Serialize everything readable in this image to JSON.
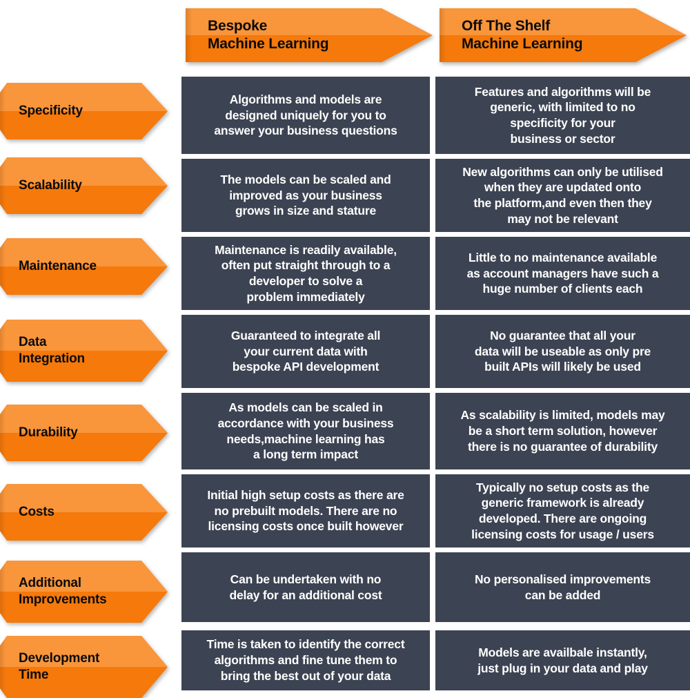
{
  "title": "Bespoke Machine Learning vs Off The Shelf Machine Learning",
  "colors": {
    "orange_light": "#F9953A",
    "orange_dark": "#F5790B",
    "cell_background": "#3C4352",
    "cell_text": "#FFFFFF",
    "label_text": "#0B0B0B",
    "page_background": "#FFFFFF"
  },
  "headers": [
    {
      "id": "bespoke",
      "label": "Bespoke\nMachine Learning"
    },
    {
      "id": "off-the-shelf",
      "label": "Off The Shelf\nMachine Learning"
    }
  ],
  "rows": [
    {
      "id": "specificity",
      "label": "Specificity",
      "bespoke": "Algorithms and models are\ndesigned uniquely for you to\nanswer your business questions",
      "off_the_shelf": "Features and algorithms will be\ngeneric, with limited to no\nspecificity for your\nbusiness or sector"
    },
    {
      "id": "scalability",
      "label": "Scalability",
      "bespoke": "The models can be scaled and\nimproved as your business\ngrows in size and stature",
      "off_the_shelf": "New algorithms can only be utilised\nwhen they are updated onto\nthe platform,and even then they\nmay not be relevant"
    },
    {
      "id": "maintenance",
      "label": "Maintenance",
      "bespoke": "Maintenance is readily available,\noften put straight through to a\ndeveloper to solve a\nproblem immediately",
      "off_the_shelf": "Little to no maintenance available\nas account managers have such a\nhuge number of clients each"
    },
    {
      "id": "data-integration",
      "label": "Data\nIntegration",
      "bespoke": "Guaranteed to integrate all\nyour current data with\nbespoke API development",
      "off_the_shelf": "No guarantee that all your\ndata will be useable as only pre\nbuilt APIs will likely be used"
    },
    {
      "id": "durability",
      "label": "Durability",
      "bespoke": "As models can be scaled in\naccordance with your business\nneeds,machine learning has\na long term impact",
      "off_the_shelf": "As scalability is limited, models may\nbe a short term solution, however\nthere is no guarantee of durability"
    },
    {
      "id": "costs",
      "label": "Costs",
      "bespoke": "Initial high setup costs as there are\nno prebuilt models. There are no\nlicensing costs once built however",
      "off_the_shelf": "Typically no setup costs as the\ngeneric framework is already\ndeveloped. There are ongoing\nlicensing costs for usage / users"
    },
    {
      "id": "additional-improvements",
      "label": "Additional\nImprovements",
      "bespoke": "Can be undertaken with no\ndelay for an additional cost",
      "off_the_shelf": "No personalised improvements\ncan be added"
    },
    {
      "id": "development-time",
      "label": "Development\nTime",
      "bespoke": "Time is taken to identify the correct\nalgorithms and fine tune them to\nbring the best out of your data",
      "off_the_shelf": "Models are availbale instantly,\njust plug in your data and play"
    }
  ]
}
